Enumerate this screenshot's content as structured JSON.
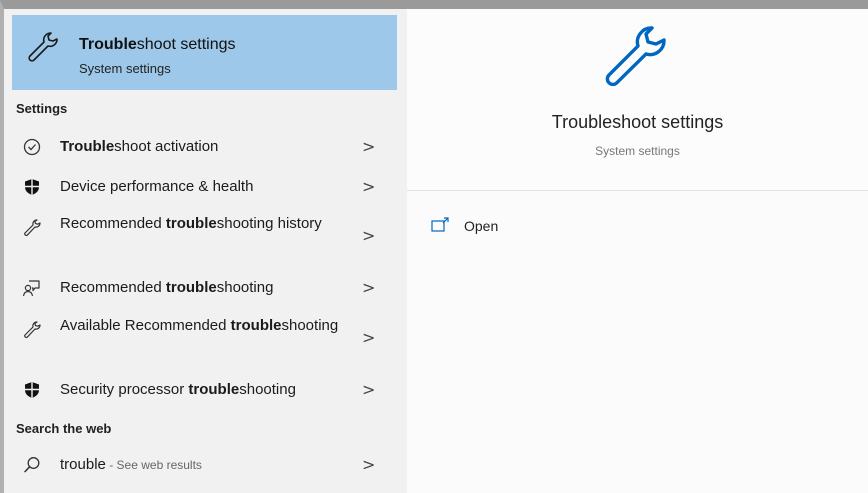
{
  "best_match": {
    "title_bold": "Trouble",
    "title_rest": "shoot settings",
    "subtitle": "System settings",
    "icon": "wrench-icon"
  },
  "sections": {
    "settings": "Settings",
    "web": "Search the web"
  },
  "results": [
    {
      "icon": "check-circle-icon",
      "bold": "Trouble",
      "rest": "shoot activation"
    },
    {
      "icon": "shield-icon",
      "plain": "Device performance & health"
    },
    {
      "icon": "wrench-icon",
      "pre": "Recommended ",
      "bold": "trouble",
      "rest": "shooting history"
    },
    {
      "icon": "chat-person-icon",
      "pre": "Recommended ",
      "bold": "trouble",
      "rest": "shooting"
    },
    {
      "icon": "wrench-icon",
      "pre": "Available Recommended ",
      "bold": "trouble",
      "rest": "shooting"
    },
    {
      "icon": "shield-icon",
      "pre": "Security processor ",
      "bold": "trouble",
      "rest": "shooting"
    }
  ],
  "web_result": {
    "icon": "search-icon",
    "query": "trouble",
    "hint": " - See web results"
  },
  "preview": {
    "title": "Troubleshoot settings",
    "subtitle": "System settings",
    "icon": "wrench-icon"
  },
  "actions": {
    "open": "Open",
    "open_icon": "open-window-icon"
  },
  "chevron": ">",
  "colors": {
    "highlight": "#9dc8e9",
    "accent": "#0067c0"
  }
}
